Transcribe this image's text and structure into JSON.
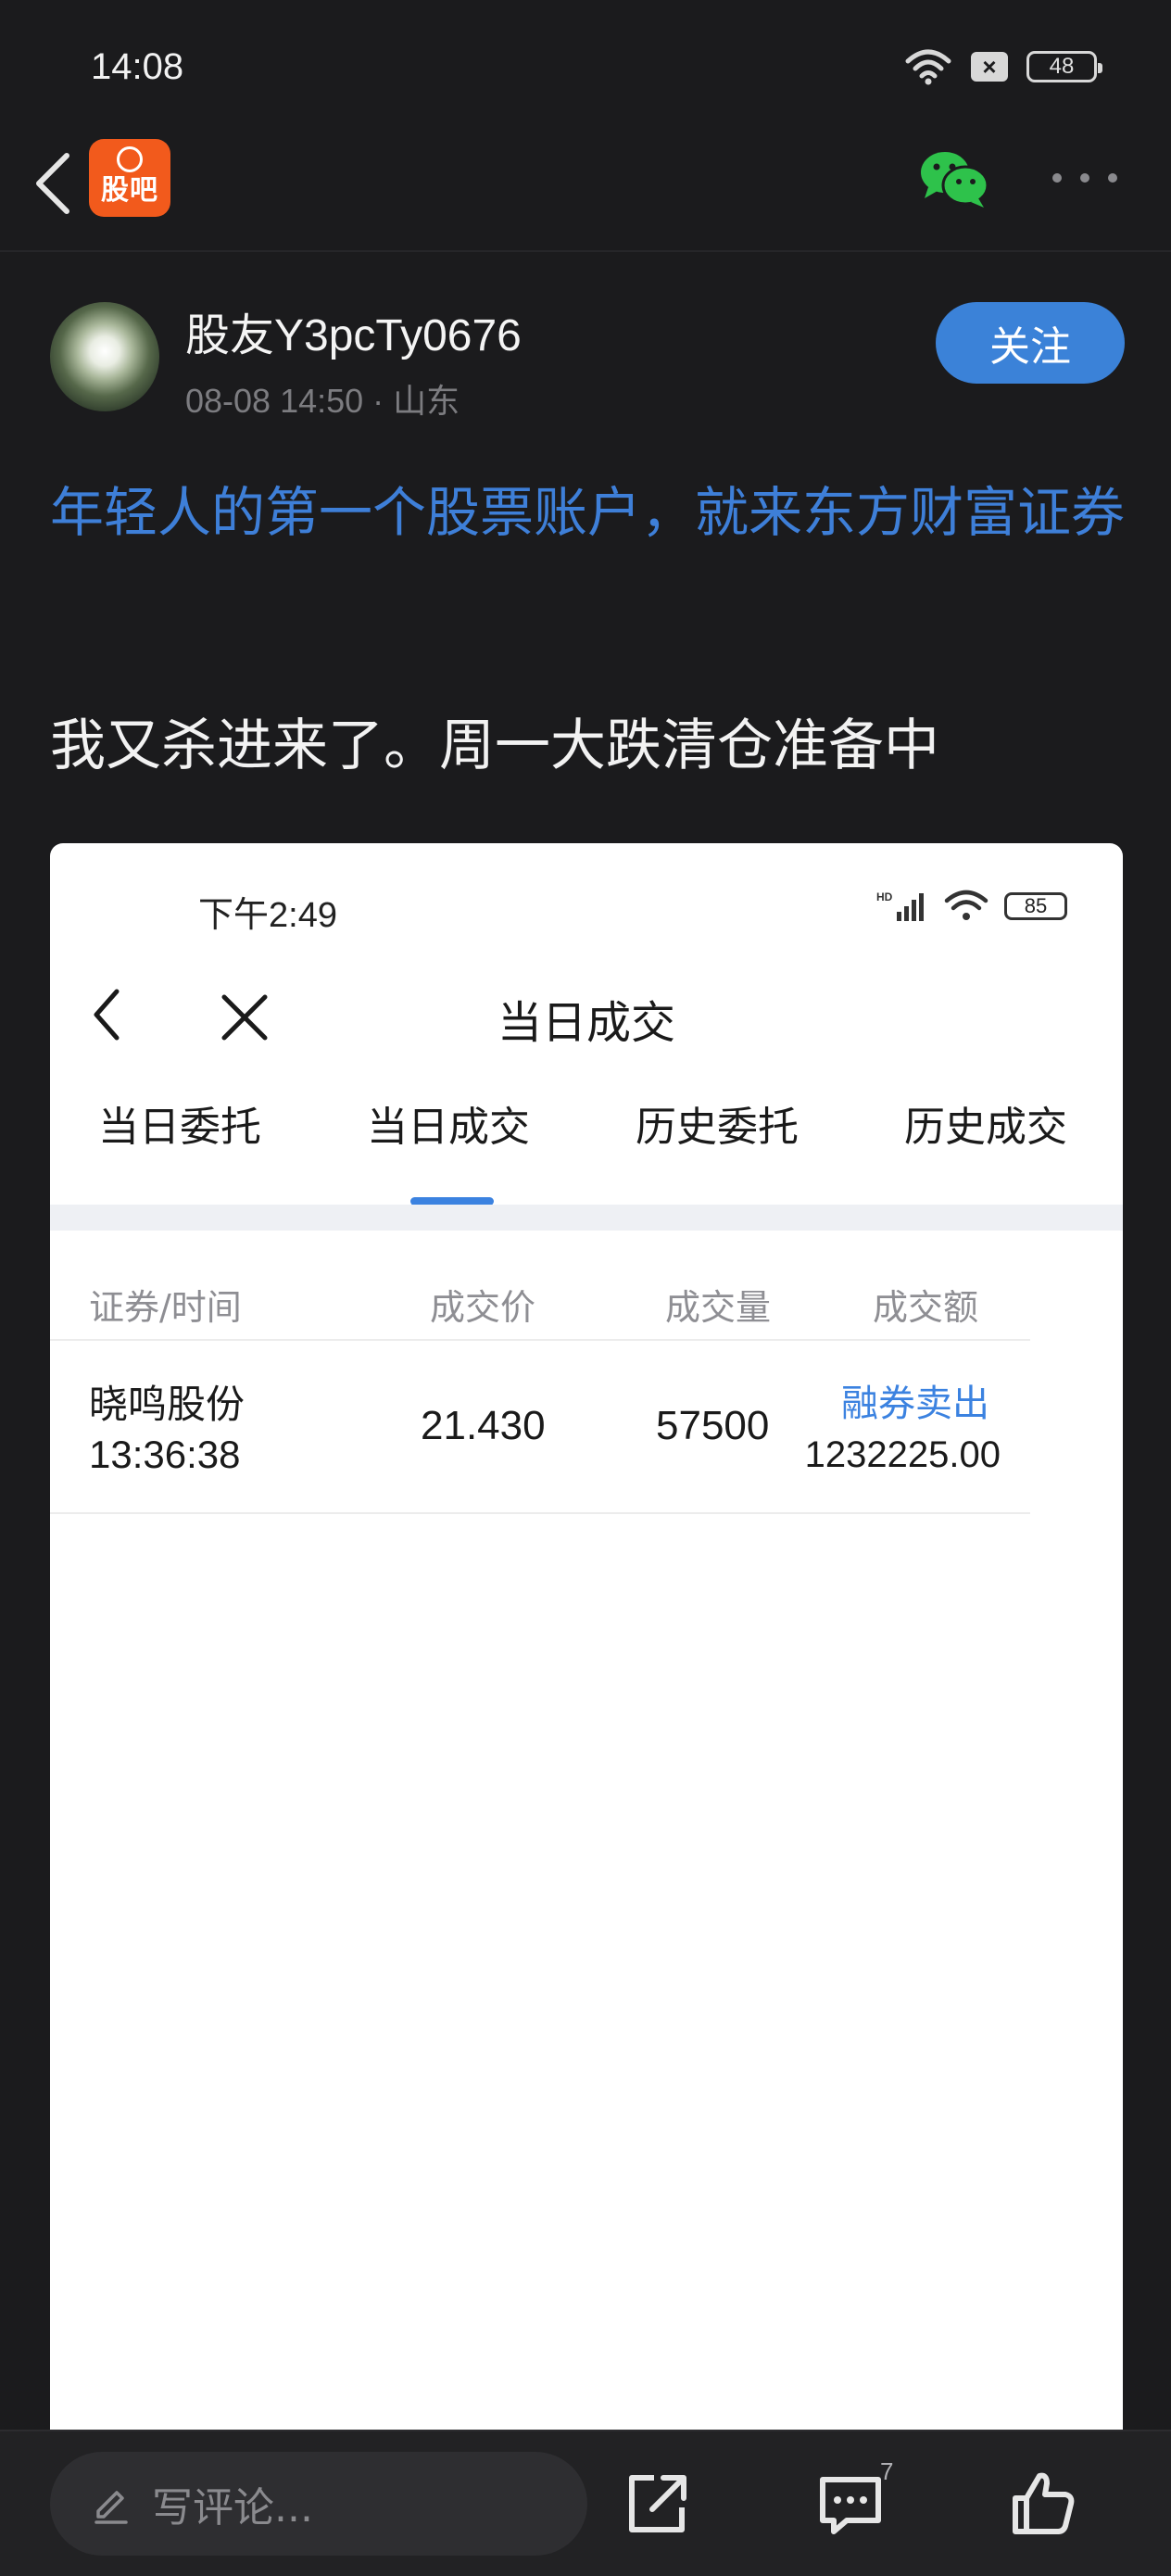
{
  "status_bar": {
    "time": "14:08",
    "battery": "48",
    "sim_badge": "×"
  },
  "header": {
    "app_logo": "股吧"
  },
  "post": {
    "author": "股友Y3pcTy0676",
    "meta": "08-08 14:50 · 山东",
    "follow_label": "关注",
    "promo_link": "年轻人的第一个股票账户，就来东方财富证券",
    "body": "我又杀进来了。周一大跌清仓准备中"
  },
  "screenshot": {
    "status_time": "下午2:49",
    "battery": "85",
    "title": "当日成交",
    "tabs": [
      {
        "label": "当日委托",
        "active": false
      },
      {
        "label": "当日成交",
        "active": true
      },
      {
        "label": "历史委托",
        "active": false
      },
      {
        "label": "历史成交",
        "active": false
      }
    ],
    "columns": [
      "证券/时间",
      "成交价",
      "成交量",
      "成交额"
    ],
    "rows": [
      {
        "name": "晓鸣股份",
        "time": "13:36:38",
        "price": "21.430",
        "volume": "57500",
        "type": "融券卖出",
        "amount": "1232225.00"
      }
    ],
    "colors": {
      "accent": "#3b82e0",
      "link": "#3e7fd8"
    }
  },
  "bottom_bar": {
    "comment_placeholder": "写评论...",
    "comment_count": "7"
  },
  "icons": [
    "back-icon",
    "wechat-icon",
    "more-icon",
    "pencil-icon",
    "share-icon",
    "comment-icon",
    "like-icon",
    "close-icon",
    "wifi-icon",
    "signal-icon"
  ]
}
